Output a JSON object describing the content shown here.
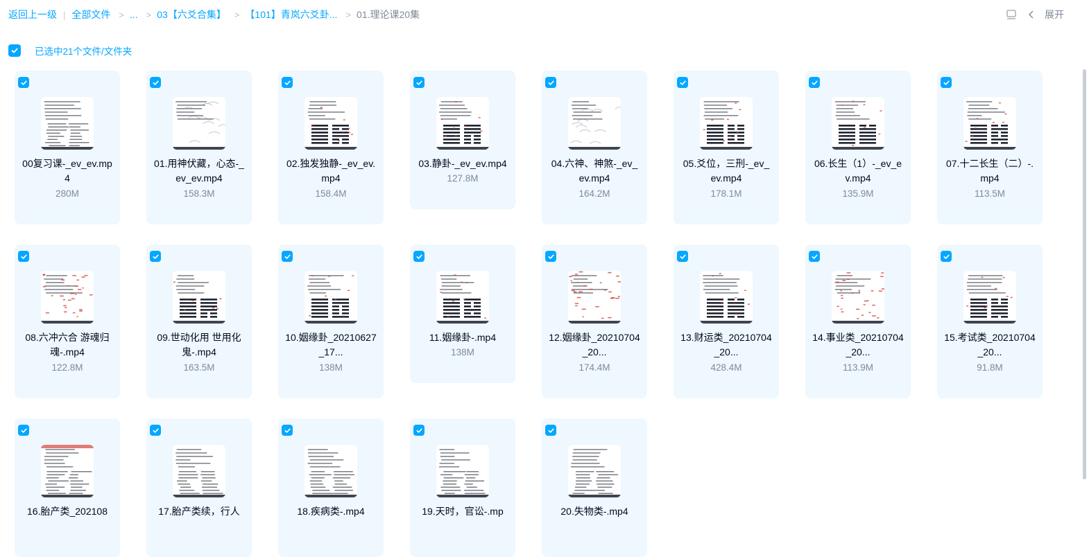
{
  "breadcrumb": {
    "back": "返回上一级",
    "all_files": "全部文件",
    "ellipsis": "...",
    "folder1": "03【六爻合集】",
    "folder2": "【101】青岚六爻卦...",
    "current": "01.理论课20集"
  },
  "toolbar": {
    "expand_label": "展开"
  },
  "selection": {
    "text": "已选中21个文件/文件夹"
  },
  "files": [
    {
      "name": "00复习课-_ev_ev.mp4",
      "size": "280M",
      "thumb": "a"
    },
    {
      "name": "01.用神伏藏，心态-_ev_ev.mp4",
      "size": "158.3M",
      "thumb": "b"
    },
    {
      "name": "02.独发独静-_ev_ev.mp4",
      "size": "158.4M",
      "thumb": "c"
    },
    {
      "name": "03.静卦-_ev_ev.mp4",
      "size": "127.8M",
      "thumb": "c"
    },
    {
      "name": "04.六神、神煞-_ev_ev.mp4",
      "size": "164.2M",
      "thumb": "b"
    },
    {
      "name": "05.爻位，三刑-_ev_ev.mp4",
      "size": "178.1M",
      "thumb": "c"
    },
    {
      "name": "06.长生（1）-_ev_ev.mp4",
      "size": "135.9M",
      "thumb": "c"
    },
    {
      "name": "07.十二长生（二）-.mp4",
      "size": "113.5M",
      "thumb": "c"
    },
    {
      "name": "08.六冲六合 游魂归魂-.mp4",
      "size": "122.8M",
      "thumb": "d"
    },
    {
      "name": "09.世动化用 世用化鬼-.mp4",
      "size": "163.5M",
      "thumb": "c"
    },
    {
      "name": "10.姻缘卦_20210627_17...",
      "size": "138M",
      "thumb": "c"
    },
    {
      "name": "11.姻缘卦-.mp4",
      "size": "138M",
      "thumb": "c"
    },
    {
      "name": "12.姻缘卦_20210704_20...",
      "size": "174.4M",
      "thumb": "d"
    },
    {
      "name": "13.财运类_20210704_20...",
      "size": "428.4M",
      "thumb": "c"
    },
    {
      "name": "14.事业类_20210704_20...",
      "size": "113.9M",
      "thumb": "d"
    },
    {
      "name": "15.考试类_20210704_20...",
      "size": "91.8M",
      "thumb": "c"
    },
    {
      "name": "16.胎产类_202108",
      "size": "",
      "thumb": "e"
    },
    {
      "name": "17.胎产类续，行人",
      "size": "",
      "thumb": "a"
    },
    {
      "name": "18.疾病类-.mp4",
      "size": "",
      "thumb": "a"
    },
    {
      "name": "19.天时，官讼-.mp",
      "size": "",
      "thumb": "a"
    },
    {
      "name": "20.失物类-.mp4",
      "size": "",
      "thumb": "a"
    }
  ],
  "colors": {
    "accent": "#06a7ff",
    "card_bg": "#eef8fe",
    "muted_text": "#818999",
    "thumb_ink": "#1e2330",
    "thumb_red": "#d6453c"
  }
}
